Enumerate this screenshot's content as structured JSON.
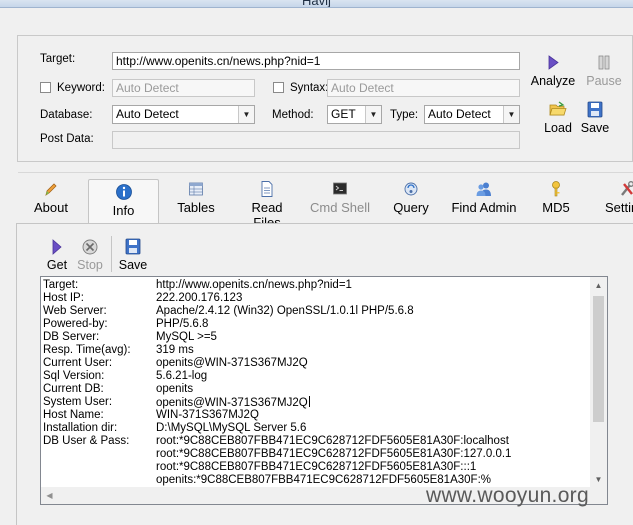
{
  "window": {
    "title": "Havij"
  },
  "target_group": {
    "target_label": "Target:",
    "target_value": "http://www.openits.cn/news.php?nid=1",
    "keyword_label": "Keyword:",
    "keyword_placeholder": "Auto Detect",
    "syntax_label": "Syntax:",
    "syntax_placeholder": "Auto Detect",
    "database_label": "Database:",
    "database_value": "Auto Detect",
    "method_label": "Method:",
    "method_value": "GET",
    "type_label": "Type:",
    "type_value": "Auto Detect",
    "postdata_label": "Post Data:",
    "postdata_value": ""
  },
  "side_buttons": {
    "analyze": "Analyze",
    "pause": "Pause",
    "load": "Load",
    "save": "Save"
  },
  "tabs": {
    "about": "About",
    "info": "Info",
    "tables": "Tables",
    "read_files": "Read Files",
    "cmd_shell": "Cmd Shell",
    "query": "Query",
    "find_admin": "Find Admin",
    "md5": "MD5",
    "settings": "Settings"
  },
  "info_toolbar": {
    "get": "Get",
    "stop": "Stop",
    "save": "Save"
  },
  "info_rows": [
    {
      "key": "Target:",
      "value": "http://www.openits.cn/news.php?nid=1"
    },
    {
      "key": "Host IP:",
      "value": "222.200.176.123"
    },
    {
      "key": "Web Server:",
      "value": "Apache/2.4.12 (Win32) OpenSSL/1.0.1l PHP/5.6.8"
    },
    {
      "key": "Powered-by:",
      "value": "PHP/5.6.8"
    },
    {
      "key": "DB Server:",
      "value": "MySQL >=5"
    },
    {
      "key": "Resp. Time(avg):",
      "value": "319 ms"
    },
    {
      "key": "Current User:",
      "value": "openits@WIN-371S367MJ2Q"
    },
    {
      "key": "Sql Version:",
      "value": "5.6.21-log"
    },
    {
      "key": "Current DB:",
      "value": "openits"
    },
    {
      "key": "System User:",
      "value": "openits@WIN-371S367MJ2Q"
    },
    {
      "key": "Host Name:",
      "value": "WIN-371S367MJ2Q"
    },
    {
      "key": "Installation dir:",
      "value": "D:\\MySQL\\MySQL Server 5.6"
    },
    {
      "key": "DB User & Pass:",
      "value": "root:*9C88CEB807FBB471EC9C628712FDF5605E81A30F:localhost"
    },
    {
      "key": "",
      "value": "root:*9C88CEB807FBB471EC9C628712FDF5605E81A30F:127.0.0.1"
    },
    {
      "key": "",
      "value": "root:*9C88CEB807FBB471EC9C628712FDF5605E81A30F:::1"
    },
    {
      "key": "",
      "value": "openits:*9C88CEB807FBB471EC9C628712FDF5605E81A30F:%"
    }
  ],
  "watermark": "www.wooyun.org",
  "colors": {
    "accent_blue": "#2a6fc9",
    "analyze_purple": "#6a4fc4",
    "disabled_text": "#9a9a9a"
  }
}
